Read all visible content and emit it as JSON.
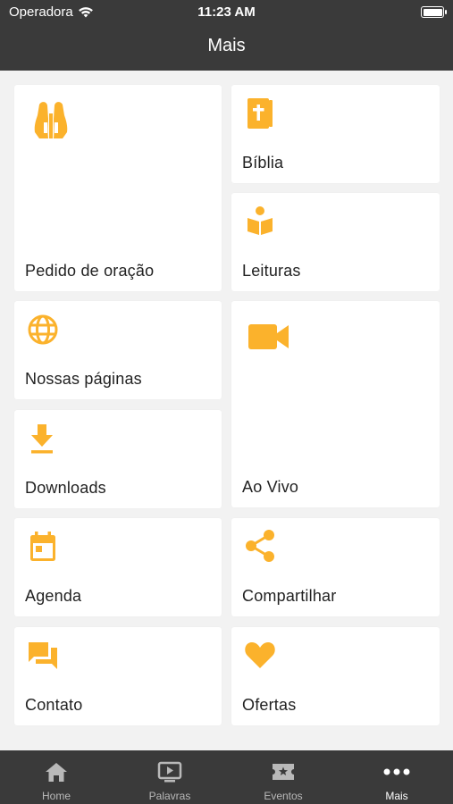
{
  "status_bar": {
    "carrier": "Operadora",
    "time": "11:23 AM"
  },
  "header": {
    "title": "Mais"
  },
  "accent_color": "#FBB22C",
  "tiles": [
    {
      "label": "Pedido de oração",
      "icon": "praying-hands-icon"
    },
    {
      "label": "Bíblia",
      "icon": "bible-icon"
    },
    {
      "label": "Leituras",
      "icon": "reading-icon"
    },
    {
      "label": "Nossas páginas",
      "icon": "globe-icon"
    },
    {
      "label": "Ao Vivo",
      "icon": "video-camera-icon"
    },
    {
      "label": "Downloads",
      "icon": "download-icon"
    },
    {
      "label": "Agenda",
      "icon": "calendar-icon"
    },
    {
      "label": "Compartilhar",
      "icon": "share-icon"
    },
    {
      "label": "Contato",
      "icon": "chat-icon"
    },
    {
      "label": "Ofertas",
      "icon": "heart-icon"
    }
  ],
  "tab_bar": {
    "active": "Mais",
    "tabs": [
      {
        "label": "Home",
        "icon": "home-icon"
      },
      {
        "label": "Palavras",
        "icon": "play-screen-icon"
      },
      {
        "label": "Eventos",
        "icon": "ticket-icon"
      },
      {
        "label": "Mais",
        "icon": "more-dots-icon"
      }
    ]
  }
}
